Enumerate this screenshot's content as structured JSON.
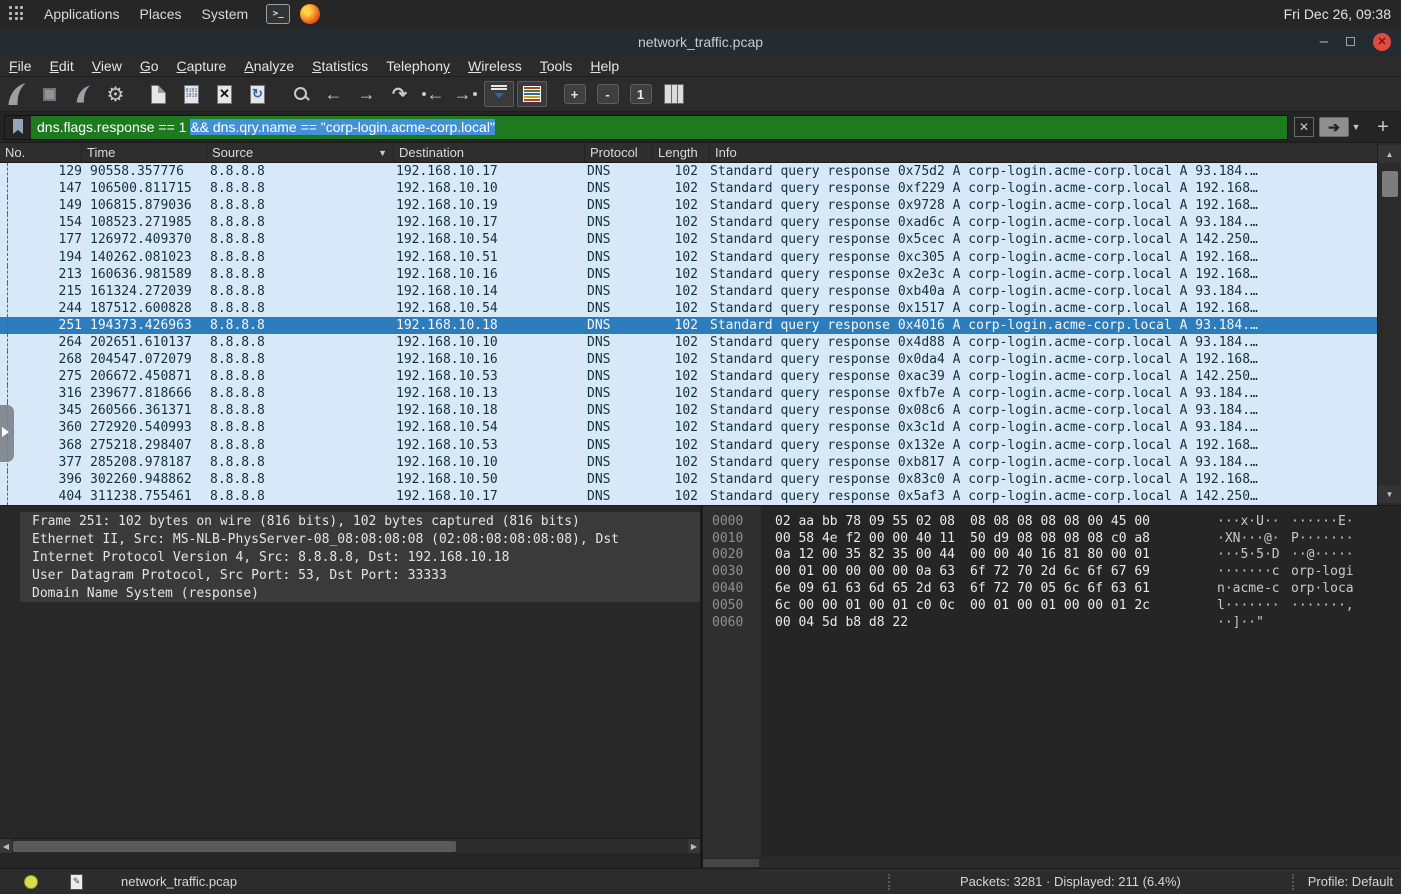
{
  "desktop": {
    "menus": {
      "applications": "Applications",
      "places": "Places",
      "system": "System"
    },
    "clock": "Fri Dec 26, 09:38"
  },
  "window": {
    "title": "network_traffic.pcap"
  },
  "menubar": {
    "items": [
      {
        "label": "File",
        "mnemonic": 0
      },
      {
        "label": "Edit",
        "mnemonic": 0
      },
      {
        "label": "View",
        "mnemonic": 0
      },
      {
        "label": "Go",
        "mnemonic": 0
      },
      {
        "label": "Capture",
        "mnemonic": 0
      },
      {
        "label": "Analyze",
        "mnemonic": 0
      },
      {
        "label": "Statistics",
        "mnemonic": 0
      },
      {
        "label": "Telephony",
        "mnemonic": 8
      },
      {
        "label": "Wireless",
        "mnemonic": 0
      },
      {
        "label": "Tools",
        "mnemonic": 0
      },
      {
        "label": "Help",
        "mnemonic": 0
      }
    ]
  },
  "toolbar": {
    "icons": [
      "start-capture-icon",
      "stop-capture-icon",
      "restart-capture-icon",
      "capture-options-icon",
      "open-file-icon",
      "save-file-icon",
      "close-file-icon",
      "reload-file-icon",
      "find-packet-icon",
      "go-back-icon",
      "go-forward-icon",
      "go-to-packet-icon",
      "go-first-icon",
      "go-last-icon",
      "auto-scroll-icon",
      "colorize-icon",
      "zoom-in-icon",
      "zoom-out-icon",
      "zoom-normal-icon",
      "resize-columns-icon"
    ],
    "zoom_in_label": "+",
    "zoom_out_label": "-",
    "zoom_normal_label": "1"
  },
  "filter": {
    "text_plain": "dns.flags.response == 1 ",
    "text_selected": "&& dns.qry.name == \"corp-login.acme-corp.local\"",
    "valid_color": "#1e7a1e",
    "selection_color": "#4390d4"
  },
  "columns": {
    "no": "No.",
    "time": "Time",
    "source": "Source",
    "destination": "Destination",
    "protocol": "Protocol",
    "length": "Length",
    "info": "Info"
  },
  "packets": [
    {
      "no": "129",
      "time": "90558.357776",
      "src": "8.8.8.8",
      "dst": "192.168.10.17",
      "proto": "DNS",
      "len": "102",
      "info": "Standard query response 0x75d2 A corp-login.acme-corp.local A 93.184.…"
    },
    {
      "no": "147",
      "time": "106500.811715",
      "src": "8.8.8.8",
      "dst": "192.168.10.10",
      "proto": "DNS",
      "len": "102",
      "info": "Standard query response 0xf229 A corp-login.acme-corp.local A 192.168…"
    },
    {
      "no": "149",
      "time": "106815.879036",
      "src": "8.8.8.8",
      "dst": "192.168.10.19",
      "proto": "DNS",
      "len": "102",
      "info": "Standard query response 0x9728 A corp-login.acme-corp.local A 192.168…"
    },
    {
      "no": "154",
      "time": "108523.271985",
      "src": "8.8.8.8",
      "dst": "192.168.10.17",
      "proto": "DNS",
      "len": "102",
      "info": "Standard query response 0xad6c A corp-login.acme-corp.local A 93.184.…"
    },
    {
      "no": "177",
      "time": "126972.409370",
      "src": "8.8.8.8",
      "dst": "192.168.10.54",
      "proto": "DNS",
      "len": "102",
      "info": "Standard query response 0x5cec A corp-login.acme-corp.local A 142.250…"
    },
    {
      "no": "194",
      "time": "140262.081023",
      "src": "8.8.8.8",
      "dst": "192.168.10.51",
      "proto": "DNS",
      "len": "102",
      "info": "Standard query response 0xc305 A corp-login.acme-corp.local A 192.168…"
    },
    {
      "no": "213",
      "time": "160636.981589",
      "src": "8.8.8.8",
      "dst": "192.168.10.16",
      "proto": "DNS",
      "len": "102",
      "info": "Standard query response 0x2e3c A corp-login.acme-corp.local A 192.168…"
    },
    {
      "no": "215",
      "time": "161324.272039",
      "src": "8.8.8.8",
      "dst": "192.168.10.14",
      "proto": "DNS",
      "len": "102",
      "info": "Standard query response 0xb40a A corp-login.acme-corp.local A 93.184.…"
    },
    {
      "no": "244",
      "time": "187512.600828",
      "src": "8.8.8.8",
      "dst": "192.168.10.54",
      "proto": "DNS",
      "len": "102",
      "info": "Standard query response 0x1517 A corp-login.acme-corp.local A 192.168…"
    },
    {
      "no": "251",
      "time": "194373.426963",
      "src": "8.8.8.8",
      "dst": "192.168.10.18",
      "proto": "DNS",
      "len": "102",
      "info": "Standard query response 0x4016 A corp-login.acme-corp.local A 93.184.…",
      "selected": true
    },
    {
      "no": "264",
      "time": "202651.610137",
      "src": "8.8.8.8",
      "dst": "192.168.10.10",
      "proto": "DNS",
      "len": "102",
      "info": "Standard query response 0x4d88 A corp-login.acme-corp.local A 93.184.…"
    },
    {
      "no": "268",
      "time": "204547.072079",
      "src": "8.8.8.8",
      "dst": "192.168.10.16",
      "proto": "DNS",
      "len": "102",
      "info": "Standard query response 0x0da4 A corp-login.acme-corp.local A 192.168…"
    },
    {
      "no": "275",
      "time": "206672.450871",
      "src": "8.8.8.8",
      "dst": "192.168.10.53",
      "proto": "DNS",
      "len": "102",
      "info": "Standard query response 0xac39 A corp-login.acme-corp.local A 142.250…"
    },
    {
      "no": "316",
      "time": "239677.818666",
      "src": "8.8.8.8",
      "dst": "192.168.10.13",
      "proto": "DNS",
      "len": "102",
      "info": "Standard query response 0xfb7e A corp-login.acme-corp.local A 93.184.…"
    },
    {
      "no": "345",
      "time": "260566.361371",
      "src": "8.8.8.8",
      "dst": "192.168.10.18",
      "proto": "DNS",
      "len": "102",
      "info": "Standard query response 0x08c6 A corp-login.acme-corp.local A 93.184.…"
    },
    {
      "no": "360",
      "time": "272920.540993",
      "src": "8.8.8.8",
      "dst": "192.168.10.54",
      "proto": "DNS",
      "len": "102",
      "info": "Standard query response 0x3c1d A corp-login.acme-corp.local A 93.184.…"
    },
    {
      "no": "368",
      "time": "275218.298407",
      "src": "8.8.8.8",
      "dst": "192.168.10.53",
      "proto": "DNS",
      "len": "102",
      "info": "Standard query response 0x132e A corp-login.acme-corp.local A 192.168…"
    },
    {
      "no": "377",
      "time": "285208.978187",
      "src": "8.8.8.8",
      "dst": "192.168.10.10",
      "proto": "DNS",
      "len": "102",
      "info": "Standard query response 0xb817 A corp-login.acme-corp.local A 93.184.…"
    },
    {
      "no": "396",
      "time": "302260.948862",
      "src": "8.8.8.8",
      "dst": "192.168.10.50",
      "proto": "DNS",
      "len": "102",
      "info": "Standard query response 0x83c0 A corp-login.acme-corp.local A 192.168…"
    },
    {
      "no": "404",
      "time": "311238.755461",
      "src": "8.8.8.8",
      "dst": "192.168.10.17",
      "proto": "DNS",
      "len": "102",
      "info": "Standard query response 0x5af3 A corp-login.acme-corp.local A 142.250…"
    }
  ],
  "details": {
    "rows": [
      {
        "text": "Frame 251: 102 bytes on wire (816 bits), 102 bytes captured (816 bits)"
      },
      {
        "text": "Ethernet II, Src: MS-NLB-PhysServer-08_08:08:08:08 (02:08:08:08:08:08), Dst"
      },
      {
        "text": "Internet Protocol Version 4, Src: 8.8.8.8, Dst: 192.168.10.18"
      },
      {
        "text": "User Datagram Protocol, Src Port: 53, Dst Port: 33333"
      },
      {
        "text": "Domain Name System (response)"
      }
    ]
  },
  "hexdump": {
    "rows": [
      {
        "off": "0000",
        "h1": "02 aa bb 78 09 55 02 08",
        "h2": "08 08 08 08 08 00 45 00",
        "a1": "···x·U··",
        "a2": "······E·"
      },
      {
        "off": "0010",
        "h1": "00 58 4e f2 00 00 40 11",
        "h2": "50 d9 08 08 08 08 c0 a8",
        "a1": "·XN···@·",
        "a2": "P·······"
      },
      {
        "off": "0020",
        "h1": "0a 12 00 35 82 35 00 44",
        "h2": "00 00 40 16 81 80 00 01",
        "a1": "···5·5·D",
        "a2": "··@·····"
      },
      {
        "off": "0030",
        "h1": "00 01 00 00 00 00 0a 63",
        "h2": "6f 72 70 2d 6c 6f 67 69",
        "a1": "·······c",
        "a2": "orp-logi"
      },
      {
        "off": "0040",
        "h1": "6e 09 61 63 6d 65 2d 63",
        "h2": "6f 72 70 05 6c 6f 63 61",
        "a1": "n·acme-c",
        "a2": "orp·loca"
      },
      {
        "off": "0050",
        "h1": "6c 00 00 01 00 01 c0 0c",
        "h2": "00 01 00 01 00 00 01 2c",
        "a1": "l·······",
        "a2": "·······,"
      },
      {
        "off": "0060",
        "h1": "00 04 5d b8 d8 22",
        "h2": "",
        "a1": "··]··\"",
        "a2": ""
      }
    ]
  },
  "status": {
    "filename": "network_traffic.pcap",
    "packets_info": "Packets: 3281 · Displayed: 211 (6.4%)",
    "profile": "Profile: Default"
  },
  "colors": {
    "dns_row_bg": "#d7e8f8",
    "selected_row_bg": "#2d7cbb",
    "filter_valid_bg": "#1e7a1e",
    "filter_selection_bg": "#4390d4",
    "close_button": "#df4b41",
    "expert_indicator": "#d9dd4e"
  }
}
